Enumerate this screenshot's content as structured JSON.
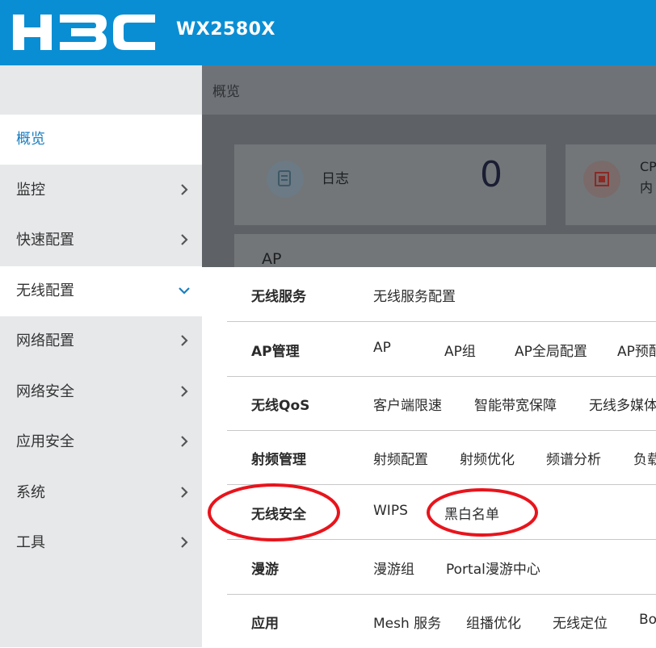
{
  "header": {
    "brand": "H3C",
    "model": "WX2580X"
  },
  "sidebar": {
    "items": [
      {
        "label": "概览",
        "state": "active"
      },
      {
        "label": "监控"
      },
      {
        "label": "快速配置"
      },
      {
        "label": "无线配置",
        "state": "expanded"
      },
      {
        "label": "网络配置"
      },
      {
        "label": "网络安全"
      },
      {
        "label": "应用安全"
      },
      {
        "label": "系统"
      },
      {
        "label": "工具"
      }
    ]
  },
  "main": {
    "breadcrumb": "概览",
    "cards": [
      {
        "label": "日志",
        "count": "0",
        "icon": "log-icon"
      },
      {
        "label_line1": "CP",
        "label_line2": "内",
        "icon": "cpu-icon"
      }
    ],
    "panel_title": "AP"
  },
  "menu": {
    "rows": [
      {
        "title": "无线服务",
        "links": [
          "无线服务配置"
        ]
      },
      {
        "title": "AP管理",
        "links": [
          "AP",
          "AP组",
          "AP全局配置",
          "AP预配"
        ]
      },
      {
        "title": "无线QoS",
        "links": [
          "客户端限速",
          "智能带宽保障",
          "无线多媒体"
        ]
      },
      {
        "title": "射频管理",
        "links": [
          "射频配置",
          "射频优化",
          "频谱分析",
          "负载"
        ]
      },
      {
        "title": "无线安全",
        "links": [
          "WIPS",
          "黑白名单"
        ]
      },
      {
        "title": "漫游",
        "links": [
          "漫游组",
          "Portal漫游中心"
        ]
      },
      {
        "title": "应用",
        "links": [
          "Mesh 服务",
          "组播优化",
          "无线定位",
          "Bo"
        ]
      }
    ]
  },
  "colors": {
    "header_bg": "#0a8ed3",
    "active_text": "#1a7fc1",
    "annotation": "#e8141c"
  }
}
